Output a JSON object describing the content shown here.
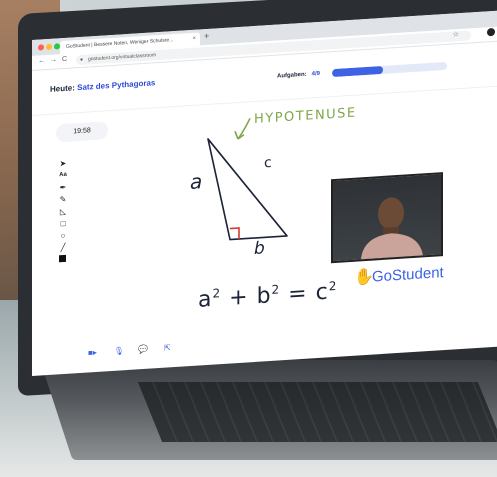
{
  "browser": {
    "tab_title": "GoStudent | Bessere Noten, Weniger Schulsre...",
    "tab_close": "×",
    "new_tab": "+",
    "url": "gostudent.org/virtualclassroom",
    "nav_back": "←",
    "nav_forward": "→",
    "nav_reload": "C"
  },
  "header": {
    "lesson_prefix": "Heute:",
    "lesson_topic": "Satz des Pythagoras",
    "progress_label": "Aufgaben:",
    "progress_count": "4/9",
    "progress_fraction": 0.44
  },
  "sidebar": {
    "timer": "19:58",
    "tools": [
      "pointer-icon",
      "text-tool-icon",
      "pen-icon",
      "marker-icon",
      "line-icon",
      "rectangle-icon",
      "circle-icon",
      "straight-line-icon",
      "color-black"
    ],
    "text_tool_label": "Aa"
  },
  "whiteboard": {
    "hypotenuse_label": "HYPOTENUSE",
    "side_a": "a",
    "side_b": "b",
    "side_c": "c",
    "formula": {
      "a": "a",
      "plus": "+",
      "b": "b",
      "equals": "=",
      "c": "c",
      "exp": "2"
    }
  },
  "video": {
    "participant": "tutor-video"
  },
  "brand": {
    "name": "GoStudent",
    "color": "#3d63e4"
  },
  "toolbar": [
    "camera-icon",
    "microphone-icon",
    "chat-icon",
    "share-icon"
  ],
  "colors": {
    "accent": "#2d4bd8",
    "hypotenuse": "#7fa64a",
    "right_angle": "#d8382b",
    "ink": "#1b2337"
  }
}
